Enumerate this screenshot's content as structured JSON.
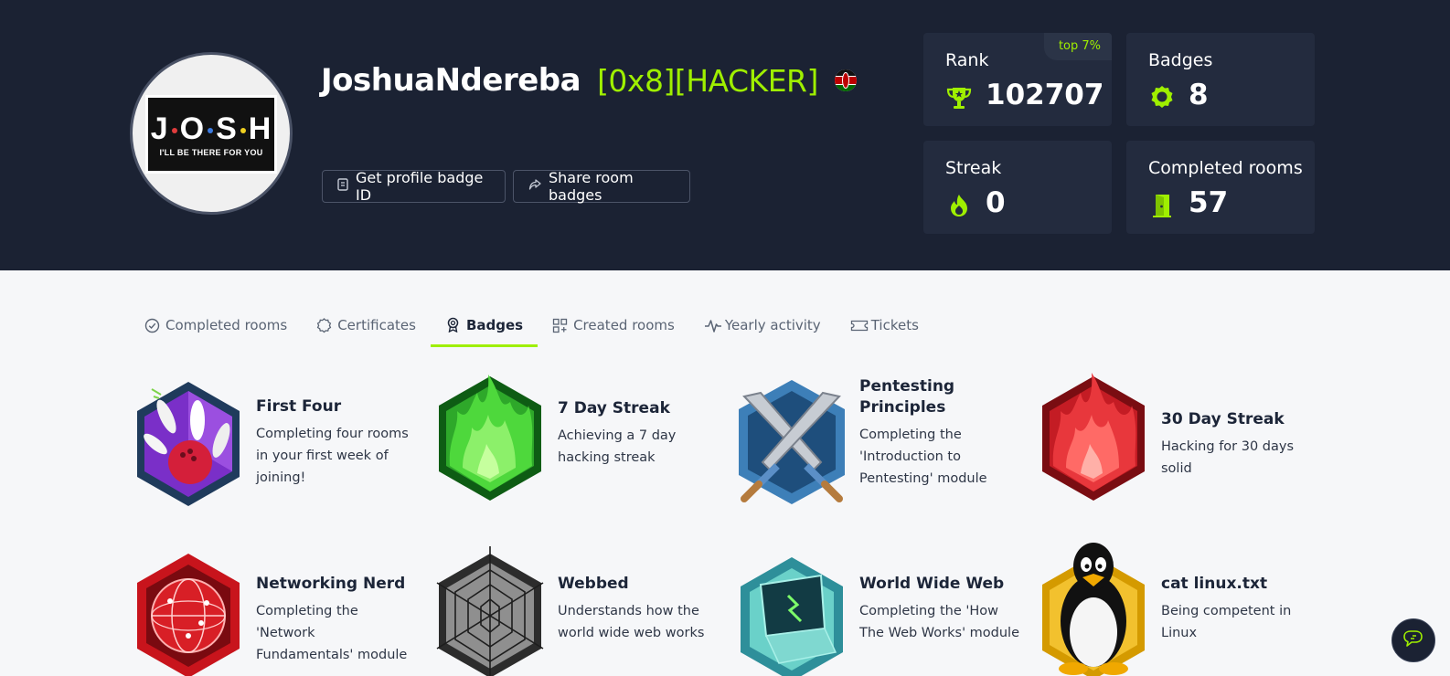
{
  "profile": {
    "username": "JoshuaNdereba",
    "rank_title": "[0x8][HACKER]",
    "avatar": {
      "word": "JOSH",
      "tagline": "I'LL BE THERE FOR YOU"
    },
    "country_flag_icon": "kenya-flag-icon"
  },
  "actions": {
    "badge_id_label": "Get profile badge ID",
    "share_label": "Share room badges"
  },
  "stats": {
    "rank": {
      "label": "Rank",
      "value": "102707",
      "top_label": "top 7%",
      "icon": "trophy-icon"
    },
    "badges": {
      "label": "Badges",
      "value": "8",
      "icon": "award-icon"
    },
    "streak": {
      "label": "Streak",
      "value": "0",
      "icon": "flame-icon"
    },
    "completed_rooms": {
      "label": "Completed rooms",
      "value": "57",
      "icon": "door-icon"
    }
  },
  "tabs": [
    {
      "label": "Completed rooms",
      "icon": "check-circle-icon"
    },
    {
      "label": "Certificates",
      "icon": "certificate-icon"
    },
    {
      "label": "Badges",
      "icon": "award-icon",
      "active": true
    },
    {
      "label": "Created rooms",
      "icon": "grid-plus-icon"
    },
    {
      "label": "Yearly activity",
      "icon": "activity-icon"
    },
    {
      "label": "Tickets",
      "icon": "ticket-icon"
    }
  ],
  "badges": [
    {
      "title": "First Four",
      "desc": "Completing four rooms in your first week of joining!",
      "icon": "bowling-badge-icon"
    },
    {
      "title": "7 Day Streak",
      "desc": "Achieving a 7 day hacking streak",
      "icon": "green-flame-badge-icon"
    },
    {
      "title": "Pentesting Principles",
      "desc": "Completing the 'Introduction to Pentesting' module",
      "icon": "crossed-swords-badge-icon"
    },
    {
      "title": "30 Day Streak",
      "desc": "Hacking for 30 days solid",
      "icon": "red-flame-badge-icon"
    },
    {
      "title": "Networking Nerd",
      "desc": "Completing the 'Network Fundamentals' module",
      "icon": "network-globe-badge-icon"
    },
    {
      "title": "Webbed",
      "desc": "Understands how the world wide web works",
      "icon": "spider-web-badge-icon"
    },
    {
      "title": "World Wide Web",
      "desc": "Completing the 'How The Web Works' module",
      "icon": "laptop-badge-icon"
    },
    {
      "title": "cat linux.txt",
      "desc": "Being competent in Linux",
      "icon": "penguin-badge-icon"
    }
  ],
  "colors": {
    "accent": "#9fef00",
    "hero_bg": "#1b2233",
    "card_bg": "#232b3e",
    "page_bg": "#f6f7f9"
  },
  "chat_icon": "chat-bubble-icon"
}
